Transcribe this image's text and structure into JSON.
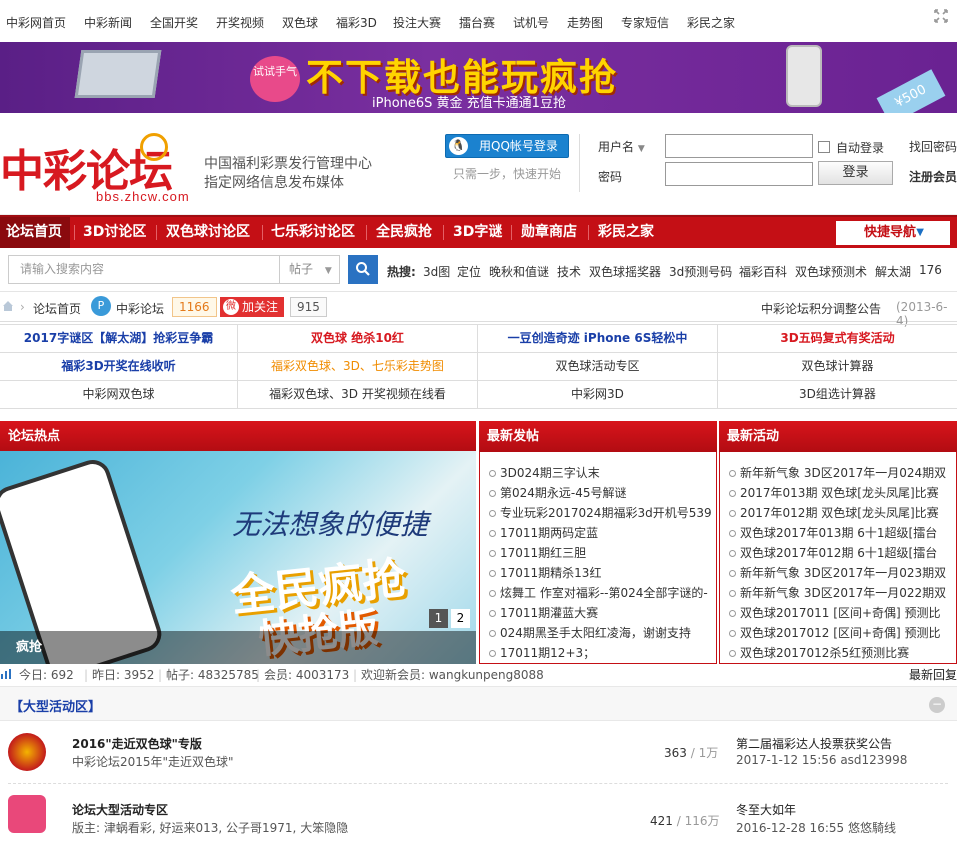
{
  "topnav": {
    "items": [
      "中彩网首页",
      "中彩新闻",
      "全国开奖",
      "开奖视频",
      "双色球",
      "福彩3D",
      "投注大赛",
      "擂台赛",
      "试机号",
      "走势图",
      "专家短信",
      "彩民之家"
    ],
    "close_icon": "fullscreen-close-icon"
  },
  "banner": {
    "badge": "试试手气",
    "slogan": "不下载也能玩疯抢",
    "sub": "iPhone6S 黄金 充值卡通通1豆抢",
    "card": "¥500"
  },
  "header": {
    "logo_text": "中彩论坛",
    "logo_url": "bbs.zhcw.com",
    "slogan1": "中国福利彩票发行管理中心",
    "slogan2": "指定网络信息发布媒体",
    "qq_login": "用QQ帐号登录",
    "qq_hint": "只需一步，快速开始",
    "username_label": "用户名",
    "password_label": "密码",
    "auto_login": "自动登录",
    "login_button": "登录",
    "forgot": "找回密码",
    "register": "注册会员"
  },
  "mainnav": {
    "items": [
      "论坛首页",
      "3D讨论区",
      "双色球讨论区",
      "七乐彩讨论区",
      "全民疯抢",
      "3D字谜",
      "勋章商店",
      "彩民之家"
    ],
    "quick": "快捷导航"
  },
  "search": {
    "placeholder": "请输入搜索内容",
    "type": "帖子",
    "hot_label": "热搜:",
    "hot": [
      "3d图",
      "定位",
      "晚秋和值谜",
      "技术",
      "双色球摇奖器",
      "3d预测号码",
      "福彩百科",
      "双色球预测术",
      "解太湖",
      "176"
    ]
  },
  "breadcrumb": {
    "home": "论坛首页",
    "forum": "中彩论坛",
    "forum_count": "1166",
    "follow": "加关注",
    "follow_count": "915",
    "notice": "中彩论坛积分调整公告",
    "notice_date": "(2013-6-4)"
  },
  "links": [
    [
      "2017字谜区【解太湖】抢彩豆争霸",
      "双色球 绝杀10红",
      "一豆创造奇迹  iPhone 6S轻松中",
      "3D五码复式有奖活动"
    ],
    [
      "福彩3D开奖在线收听",
      "福彩双色球、3D、七乐彩走势图",
      "双色球活动专区",
      "双色球计算器"
    ],
    [
      "中彩网双色球",
      "福彩双色球、3D 开奖视频在线看",
      "中彩网3D",
      "3D组选计算器"
    ]
  ],
  "hot": {
    "title": "论坛热点",
    "img_line1": "无法想象的便捷",
    "img_line2": "全民疯抢",
    "img_line3": "快抢版",
    "caption": "疯抢",
    "pages": [
      "1",
      "2"
    ]
  },
  "newposts": {
    "title": "最新发帖",
    "items": [
      "3D024期三字认末",
      "第024期永远-45号解谜",
      "专业玩彩2017024期福彩3d开机号539",
      "17011期两码定蓝",
      "17011期红三胆",
      "17011期精杀13红",
      "炫舞工 作室对福彩--第024全部字谜的-",
      "17011期灌蓝大赛",
      "024期黑圣手太阳红凌海，谢谢支持",
      "17011期12+3；"
    ]
  },
  "activities": {
    "title": "最新活动",
    "items": [
      "新年新气象 3D区2017年一月024期双",
      "2017年013期 双色球[龙头凤尾]比赛",
      "2017年012期 双色球[龙头凤尾]比赛",
      "双色球2017年013期 6十1超级[擂台",
      "双色球2017年012期 6十1超级[擂台",
      "新年新气象 3D区2017年一月023期双",
      "新年新气象 3D区2017年一月022期双",
      "双色球2017011 [区间+奇偶] 预测比",
      "双色球2017012 [区间+奇偶] 预测比",
      "双色球2017012杀5红预测比赛"
    ]
  },
  "stats": {
    "today": "今日: 692",
    "yesterday": "昨日: 3952",
    "posts": "帖子: 48325785",
    "members": "会员: 4003173",
    "welcome": "欢迎新会员: wangkunpeng8088",
    "latest": "最新回复"
  },
  "bigact": {
    "title": "【大型活动区】",
    "forums": [
      {
        "name": "2016\"走近双色球\"专版",
        "desc": "中彩论坛2015年\"走近双色球\"",
        "count": "363",
        "total": "1万",
        "last": "第二届福彩达人投票获奖公告",
        "time": "2017-1-12 15:56 asd123998"
      },
      {
        "name": "论坛大型活动专区",
        "desc": "版主: 津蜗看彩, 好运来013, 公子哥1971, 大笨隐隐",
        "count": "421",
        "total": "116万",
        "last": "冬至大如年",
        "time": "2016-12-28 16:55 悠悠騎线"
      }
    ]
  },
  "colors": {
    "brand_red": "#c40f15",
    "link_blue": "#1a3fa8",
    "accent_orange": "#f08c00"
  }
}
